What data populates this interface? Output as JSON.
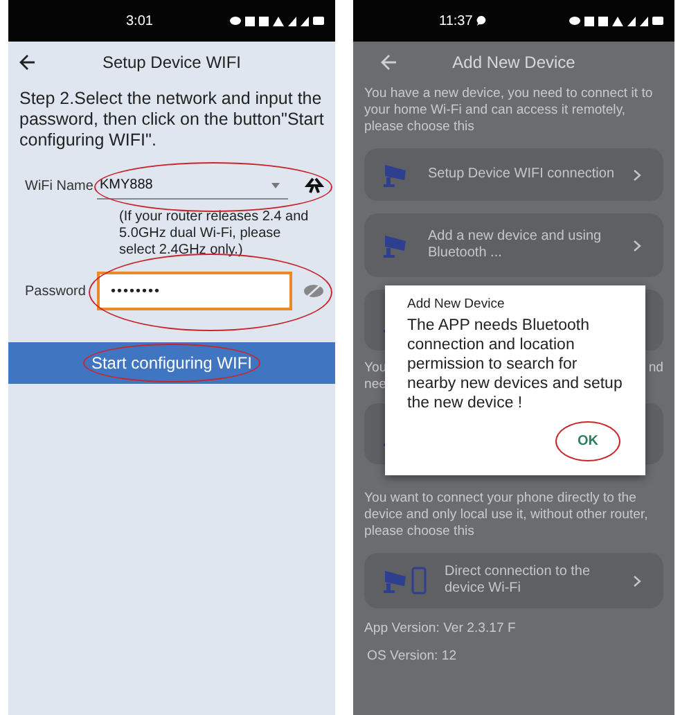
{
  "setup_screen": {
    "status_bar": {
      "time": "3:01"
    },
    "title": "Setup Device WIFI",
    "instructions": "Step 2.Select the network and input the password, then click on the button\"Start configuring WIFI\".",
    "wifi_name": {
      "label": "WiFi Name",
      "value": "KMY888",
      "circled": true
    },
    "hint": "(If your router releases 2.4 and 5.0GHz dual Wi-Fi, please select 2.4GHz only.)",
    "password": {
      "label": "Password",
      "value": "••••••••",
      "focused": true,
      "circled": true
    },
    "start_button": {
      "label": "Start configuring WIFI",
      "circled": true
    }
  },
  "add_device_screen": {
    "status_bar": {
      "time": "11:37"
    },
    "title": "Add New Device",
    "wifi_intro": "You have a new device, you need to connect it to your home Wi-Fi and can access it remotely, please choose this",
    "options": [
      {
        "kind": "option",
        "label": "Setup Device WIFI connection"
      },
      {
        "kind": "option",
        "label": "Add a new device and using Bluetooth ..."
      },
      {
        "kind": "covered"
      }
    ],
    "covered_text": {
      "left_lines": [
        "You",
        "nee"
      ],
      "right": "nd"
    },
    "more_options": [
      {
        "kind": "covered"
      }
    ],
    "direct_intro": "You want to connect your phone directly to the device and only local use it, without other router, please choose this",
    "direct_options": [
      {
        "kind": "direct",
        "label": "Direct connection to the device Wi-Fi"
      }
    ],
    "app_version": "App Version: Ver 2.3.17 F",
    "os_version": "OS Version: 12",
    "dialog": {
      "title": "Add New Device",
      "message": "The APP needs Bluetooth connection and location permission to search for nearby new devices and setup the new device !",
      "ok_button": {
        "label": "OK",
        "circled": true
      }
    }
  }
}
